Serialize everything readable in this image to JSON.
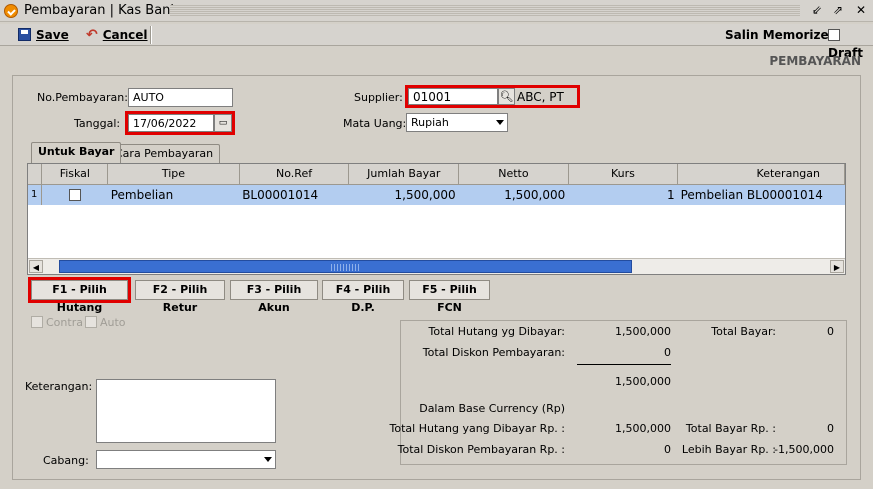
{
  "window": {
    "title": "Pembayaran | Kas Bank"
  },
  "toolbar": {
    "save_label": "Save",
    "cancel_label": "Cancel",
    "memorized_label": "Salin Memorized",
    "draft_label": "Draft"
  },
  "section_title": "PEMBAYARAN",
  "form": {
    "no_pembayaran_label": "No.Pembayaran:",
    "no_pembayaran_value": "AUTO",
    "tanggal_label": "Tanggal:",
    "tanggal_value": "17/06/2022",
    "supplier_label": "Supplier:",
    "supplier_code": "01001",
    "supplier_name": "ABC, PT",
    "mata_uang_label": "Mata Uang:",
    "mata_uang_value": "Rupiah"
  },
  "tabs": [
    {
      "label": "Untuk Bayar"
    },
    {
      "label": "Cara Pembayaran"
    }
  ],
  "grid": {
    "columns": [
      "Fiskal",
      "Tipe",
      "No.Ref",
      "Jumlah Bayar",
      "Netto",
      "Kurs",
      "Keterangan"
    ],
    "rows": [
      {
        "no": "1",
        "tipe": "Pembelian",
        "noref": "BL00001014",
        "jumlah": "1,500,000",
        "netto": "1,500,000",
        "kurs": "1",
        "keterangan": "Pembelian BL00001014"
      }
    ]
  },
  "buttons": {
    "f1": "F1 - Pilih Hutang",
    "f2": "F2 - Pilih Retur",
    "f3": "F3 - Pilih Akun",
    "f4": "F4 - Pilih D.P.",
    "f5": "F5 - Pilih FCN"
  },
  "options": {
    "contra": "Contra",
    "auto": "Auto"
  },
  "keterangan_label": "Keterangan:",
  "cabang_label": "Cabang:",
  "totals": {
    "total_hutang_label": "Total Hutang yg Dibayar:",
    "total_hutang_value": "1,500,000",
    "total_diskon_label": "Total Diskon Pembayaran:",
    "total_diskon_value": "0",
    "subtotal_value": "1,500,000",
    "total_bayar_label": "Total Bayar:",
    "total_bayar_value": "0",
    "base_currency_label": "Dalam Base Currency (Rp)",
    "total_hutang_rp_label": "Total Hutang yang Dibayar Rp. :",
    "total_hutang_rp_value": "1,500,000",
    "total_diskon_rp_label": "Total Diskon Pembayaran Rp. :",
    "total_diskon_rp_value": "0",
    "total_bayar_rp_label": "Total Bayar Rp. :",
    "total_bayar_rp_value": "0",
    "lebih_bayar_label": "Lebih Bayar Rp. :",
    "lebih_bayar_value": "-1,500,000"
  },
  "colors": {
    "highlight": "#e00000",
    "selected_row": "#b3cdf0",
    "scroll_thumb": "#3a6fd1"
  }
}
